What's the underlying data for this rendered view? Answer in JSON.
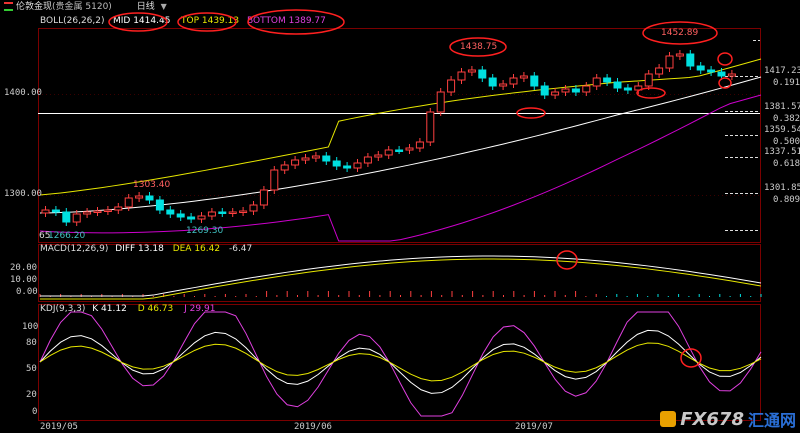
{
  "window": {
    "title": "伦敦金现",
    "subtitle": "(贵金属 5120)",
    "period": "日线"
  },
  "boll": {
    "params": "BOLL(26,26,2)",
    "mid": "MID 1414.45",
    "top": "TOP 1439.13",
    "bottom": "BOTTOM 1389.77",
    "colors": {
      "mid": "#ffffff",
      "top": "#e6e600",
      "bottom": "#cc00cc"
    }
  },
  "macd": {
    "params": "MACD(12,26,9)",
    "diff": "DIFF 13.18",
    "dea": "DEA 16.42",
    "macd": "-6.47"
  },
  "kdj": {
    "params": "KDJ(9,3,3)",
    "k": "K 41.12",
    "d": "D 46.73",
    "j": "J 29.91"
  },
  "price_axis": [
    "1400.00",
    "1300.00"
  ],
  "macd_axis": [
    "20.00",
    "10.00",
    "0.00"
  ],
  "kdj_axis": [
    "100",
    "80",
    "50",
    "20",
    "0"
  ],
  "dates": [
    "2019/05",
    "2019/06",
    "2019/07"
  ],
  "annotations": {
    "high1": "1438.75",
    "high2": "1452.89",
    "peak_may": "1303.40",
    "low_may": "1269.30",
    "low_left": "1266.20",
    "small_left": "65"
  },
  "fib_levels": [
    {
      "price": "1417.23",
      "ratio": "0.191"
    },
    {
      "price": "1381.57",
      "ratio": "0.382"
    },
    {
      "price": "1359.54",
      "ratio": "0.500"
    },
    {
      "price": "1337.51",
      "ratio": "0.618"
    },
    {
      "price": "1301.85",
      "ratio": "0.809"
    }
  ],
  "watermark": {
    "brand": "FX678",
    "cn": "汇通网"
  }
}
